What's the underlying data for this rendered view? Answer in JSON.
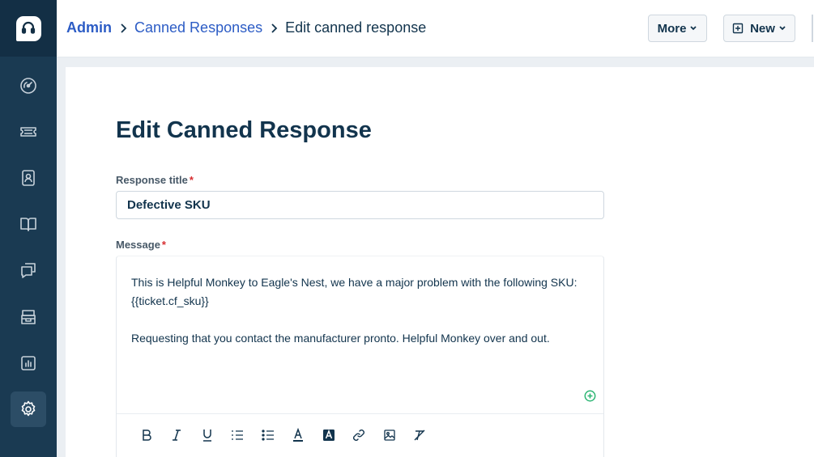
{
  "breadcrumb": {
    "admin": "Admin",
    "section": "Canned Responses",
    "current": "Edit canned response"
  },
  "header": {
    "more_label": "More",
    "new_label": "New"
  },
  "sidebar": {
    "items": [
      {
        "name": "dashboard",
        "icon": "dashboard-gauge-icon"
      },
      {
        "name": "tickets",
        "icon": "ticket-icon"
      },
      {
        "name": "contacts",
        "icon": "contact-card-icon"
      },
      {
        "name": "solutions",
        "icon": "book-icon"
      },
      {
        "name": "forums",
        "icon": "discussion-icon"
      },
      {
        "name": "inventory",
        "icon": "box-icon"
      },
      {
        "name": "reports",
        "icon": "bar-chart-icon"
      },
      {
        "name": "admin",
        "icon": "gear-icon",
        "active": true
      }
    ]
  },
  "form": {
    "page_title": "Edit Canned Response",
    "title_label": "Response title",
    "title_value": "Defective SKU",
    "message_label": "Message",
    "required_mark": "*",
    "message_line1": "This is Helpful Monkey to Eagle's Nest, we have a major problem with the following SKU: {{ticket.cf_sku}}",
    "message_line2": "Requesting that you contact the manufacturer pronto. Helpful Monkey over and out."
  },
  "toolbar": {
    "buttons": [
      "bold",
      "italic",
      "underline",
      "ordered-list",
      "bulleted-list",
      "font-color",
      "background-color",
      "insert-link",
      "insert-image",
      "clear-formatting"
    ]
  },
  "colors": {
    "sidebar_bg": "#1a3a52",
    "accent_link": "#2c5cc5",
    "required": "#d72d30",
    "add_green": "#2cb573"
  }
}
